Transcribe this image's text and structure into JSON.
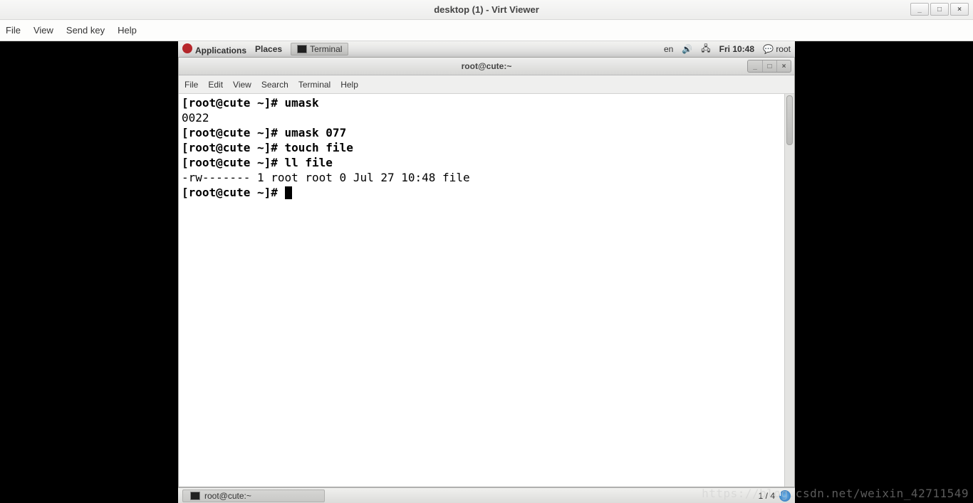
{
  "outer": {
    "title": "desktop (1) - Virt Viewer",
    "menus": {
      "file": "File",
      "view": "View",
      "sendkey": "Send key",
      "help": "Help"
    }
  },
  "gnome_top": {
    "applications": "Applications",
    "places": "Places",
    "terminal": "Terminal",
    "lang": "en",
    "clock": "Fri 10:48",
    "user": "root"
  },
  "term_window": {
    "title": "root@cute:~",
    "menus": {
      "file": "File",
      "edit": "Edit",
      "view": "View",
      "search": "Search",
      "terminal": "Terminal",
      "help": "Help"
    }
  },
  "terminal": {
    "lines": [
      {
        "prompt": "[root@cute ~]# ",
        "cmd": "umask"
      },
      {
        "out": "0022"
      },
      {
        "prompt": "[root@cute ~]# ",
        "cmd": "umask 077"
      },
      {
        "prompt": "[root@cute ~]# ",
        "cmd": "touch file"
      },
      {
        "prompt": "[root@cute ~]# ",
        "cmd": "ll file"
      },
      {
        "out": "-rw------- 1 root root 0 Jul 27 10:48 file"
      },
      {
        "prompt": "[root@cute ~]# ",
        "cursor": true
      }
    ]
  },
  "gnome_bottom": {
    "task": "root@cute:~",
    "workspace": "1 / 4"
  },
  "watermark": "https://blog.csdn.net/weixin_42711549"
}
